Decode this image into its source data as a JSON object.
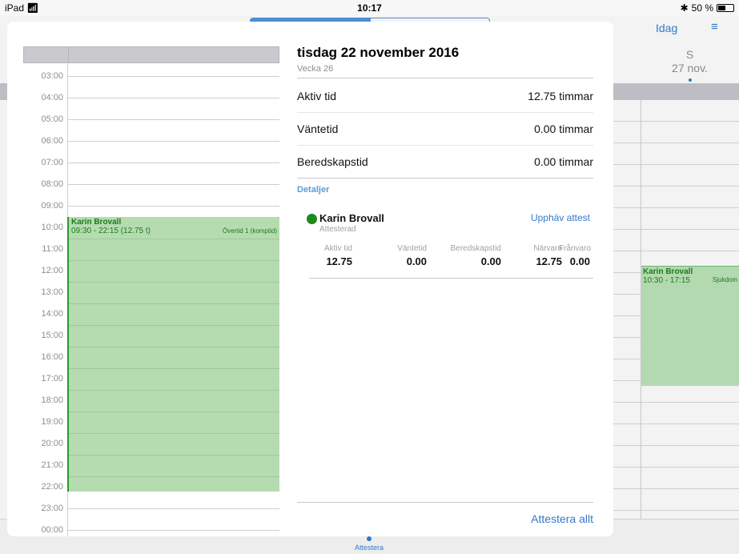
{
  "statusbar": {
    "device": "iPad",
    "wifi_icon": "wifi-icon",
    "time": "10:17",
    "battery_text": "50 %",
    "battery_level": 0.5
  },
  "background_calendar": {
    "today_button": "Idag",
    "menu_icon": "list-icon",
    "day_letter": "S",
    "day_date": "27 nov.",
    "event_person": "Karin Brovall",
    "event_time": "10:30 - 17:15",
    "event_tag": "Sjukdom",
    "tab_label": "Attestera"
  },
  "day_view": {
    "hours": [
      "03:00",
      "04:00",
      "05:00",
      "06:00",
      "07:00",
      "08:00",
      "09:00",
      "10:00",
      "11:00",
      "12:00",
      "13:00",
      "14:00",
      "15:00",
      "16:00",
      "17:00",
      "18:00",
      "19:00",
      "20:00",
      "21:00",
      "22:00",
      "23:00",
      "00:00"
    ],
    "event": {
      "person": "Karin Brovall",
      "time": "09:30 - 22:15 (12.75 t)",
      "tag": "Övertid 1 (komptid)",
      "color": "#b4dcb0"
    }
  },
  "detail": {
    "title": "tisdag 22 november 2016",
    "week": "Vecka 26",
    "stats": [
      {
        "label": "Aktiv tid",
        "value": "12.75 timmar"
      },
      {
        "label": "Väntetid",
        "value": "0.00 timmar"
      },
      {
        "label": "Beredskapstid",
        "value": "0.00 timmar"
      }
    ],
    "section_label": "Detaljer",
    "person": {
      "name": "Karin Brovall",
      "status": "Attesterad",
      "status_color": "#1a8a1a",
      "revoke_label": "Upphäv attest"
    },
    "columns": [
      {
        "header": "Aktiv tid",
        "value": "12.75"
      },
      {
        "header": "Väntetid",
        "value": "0.00"
      },
      {
        "header": "Beredskapstid",
        "value": "0.00"
      },
      {
        "header": "Närvaro",
        "value": "12.75"
      },
      {
        "header": "Frånvaro",
        "value": "0.00"
      }
    ],
    "attest_all_label": "Attestera allt"
  }
}
